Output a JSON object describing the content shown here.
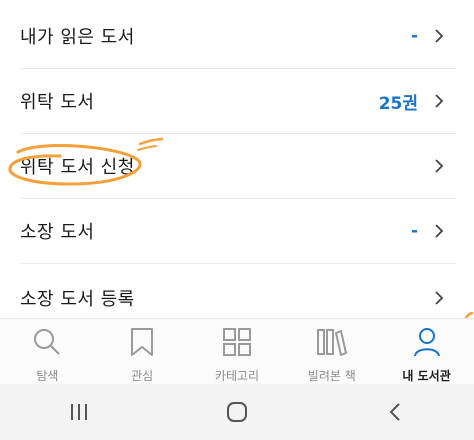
{
  "menu": [
    {
      "label": "내가 읽은 도서",
      "value": "-"
    },
    {
      "label": "위탁 도서",
      "value": "25권"
    },
    {
      "label": "위탁 도서 신청",
      "value": ""
    },
    {
      "label": "소장 도서",
      "value": "-"
    },
    {
      "label": "소장 도서 등록",
      "value": ""
    }
  ],
  "tabs": [
    {
      "label": "탐색",
      "icon": "search-icon"
    },
    {
      "label": "관심",
      "icon": "bookmark-icon"
    },
    {
      "label": "카테고리",
      "icon": "grid-icon"
    },
    {
      "label": "빌려본 책",
      "icon": "books-icon"
    },
    {
      "label": "내 도서관",
      "icon": "person-icon"
    }
  ],
  "colors": {
    "accent": "#1a73c9",
    "annotation": "#f5a03a"
  }
}
